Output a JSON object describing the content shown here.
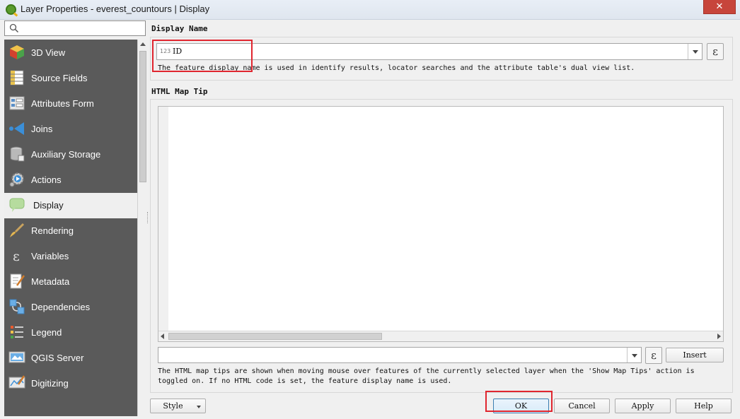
{
  "window": {
    "title": "Layer Properties - everest_countours | Display",
    "close_label": "✕"
  },
  "search": {
    "placeholder": ""
  },
  "sidebar": {
    "items": [
      {
        "label": "3D View",
        "icon": "cube-icon"
      },
      {
        "label": "Source Fields",
        "icon": "table-fields-icon"
      },
      {
        "label": "Attributes Form",
        "icon": "form-icon"
      },
      {
        "label": "Joins",
        "icon": "join-icon"
      },
      {
        "label": "Auxiliary Storage",
        "icon": "database-icon"
      },
      {
        "label": "Actions",
        "icon": "gear-play-icon"
      },
      {
        "label": "Display",
        "icon": "speech-bubble-icon"
      },
      {
        "label": "Rendering",
        "icon": "paintbrush-icon"
      },
      {
        "label": "Variables",
        "icon": "epsilon-icon"
      },
      {
        "label": "Metadata",
        "icon": "document-edit-icon"
      },
      {
        "label": "Dependencies",
        "icon": "dependencies-icon"
      },
      {
        "label": "Legend",
        "icon": "legend-icon"
      },
      {
        "label": "QGIS Server",
        "icon": "server-icon"
      },
      {
        "label": "Digitizing",
        "icon": "digitizing-icon"
      }
    ],
    "active_index": 6
  },
  "display_name": {
    "section_title": "Display Name",
    "field_type_badge": "123",
    "field_value": "ID",
    "help_text": "The feature display name is used in identify results, locator searches and the attribute table's dual view list."
  },
  "html_map_tip": {
    "section_title": "HTML Map Tip",
    "editor_content": "",
    "insert_field_value": "",
    "insert_label": "Insert",
    "help_text_line1": "The HTML map tips are shown when moving mouse over features of the currently selected layer when the 'Show Map Tips' action is",
    "help_text_line2": "toggled on. If no HTML code is set, the feature display name is used."
  },
  "footer": {
    "style_label": "Style",
    "ok_label": "OK",
    "cancel_label": "Cancel",
    "apply_label": "Apply",
    "help_label": "Help"
  },
  "colors": {
    "sidebar_bg": "#5a5a5a",
    "highlight_box": "#e0262f",
    "default_button_border": "#3c7fb1"
  }
}
